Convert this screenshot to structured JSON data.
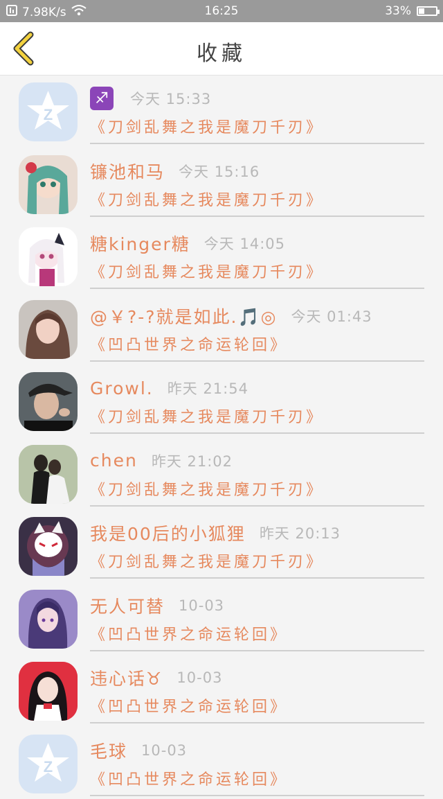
{
  "status_bar": {
    "speed": "7.98K/s",
    "time": "16:25",
    "battery": "33%",
    "battery_level": 0.33
  },
  "nav": {
    "title": "收藏"
  },
  "items": [
    {
      "name": "",
      "sign_emoji": "♐",
      "time": "今天 15:33",
      "content": "《刀剑乱舞之我是魔刀千刃》",
      "avatar": "default-q-icon"
    },
    {
      "name": "镰池和马",
      "time": "今天 15:16",
      "content": "《刀剑乱舞之我是魔刀千刃》",
      "avatar": "anime-girl-green-hair"
    },
    {
      "name": "糖kinger糖",
      "time": "今天 14:05",
      "content": "《刀剑乱舞之我是魔刀千刃》",
      "avatar": "anime-girl-white-hair"
    },
    {
      "name": "@￥?-?就是如此.🎵◎",
      "time": "今天 01:43",
      "content": "《凹凸世界之命运轮回》",
      "avatar": "photo-girl"
    },
    {
      "name": "Growl.",
      "time": "昨天 21:54",
      "content": "《刀剑乱舞之我是魔刀千刃》",
      "avatar": "photo-boy-cap"
    },
    {
      "name": "chen",
      "time": "昨天 21:02",
      "content": "《刀剑乱舞之我是魔刀千刃》",
      "avatar": "photo-couple"
    },
    {
      "name": "我是00后的小狐狸",
      "time": "昨天 20:13",
      "content": "《刀剑乱舞之我是魔刀千刃》",
      "avatar": "anime-fox-mask"
    },
    {
      "name": "无人可替",
      "time": "10-03",
      "content": "《凹凸世界之命运轮回》",
      "avatar": "anime-purple-hair"
    },
    {
      "name": "违心话♉",
      "time": "10-03",
      "content": "《凹凸世界之命运轮回》",
      "avatar": "anime-red-hair"
    },
    {
      "name": "毛球",
      "time": "10-03",
      "content": "《凹凸世界之命运轮回》",
      "avatar": "default-q-icon"
    }
  ]
}
